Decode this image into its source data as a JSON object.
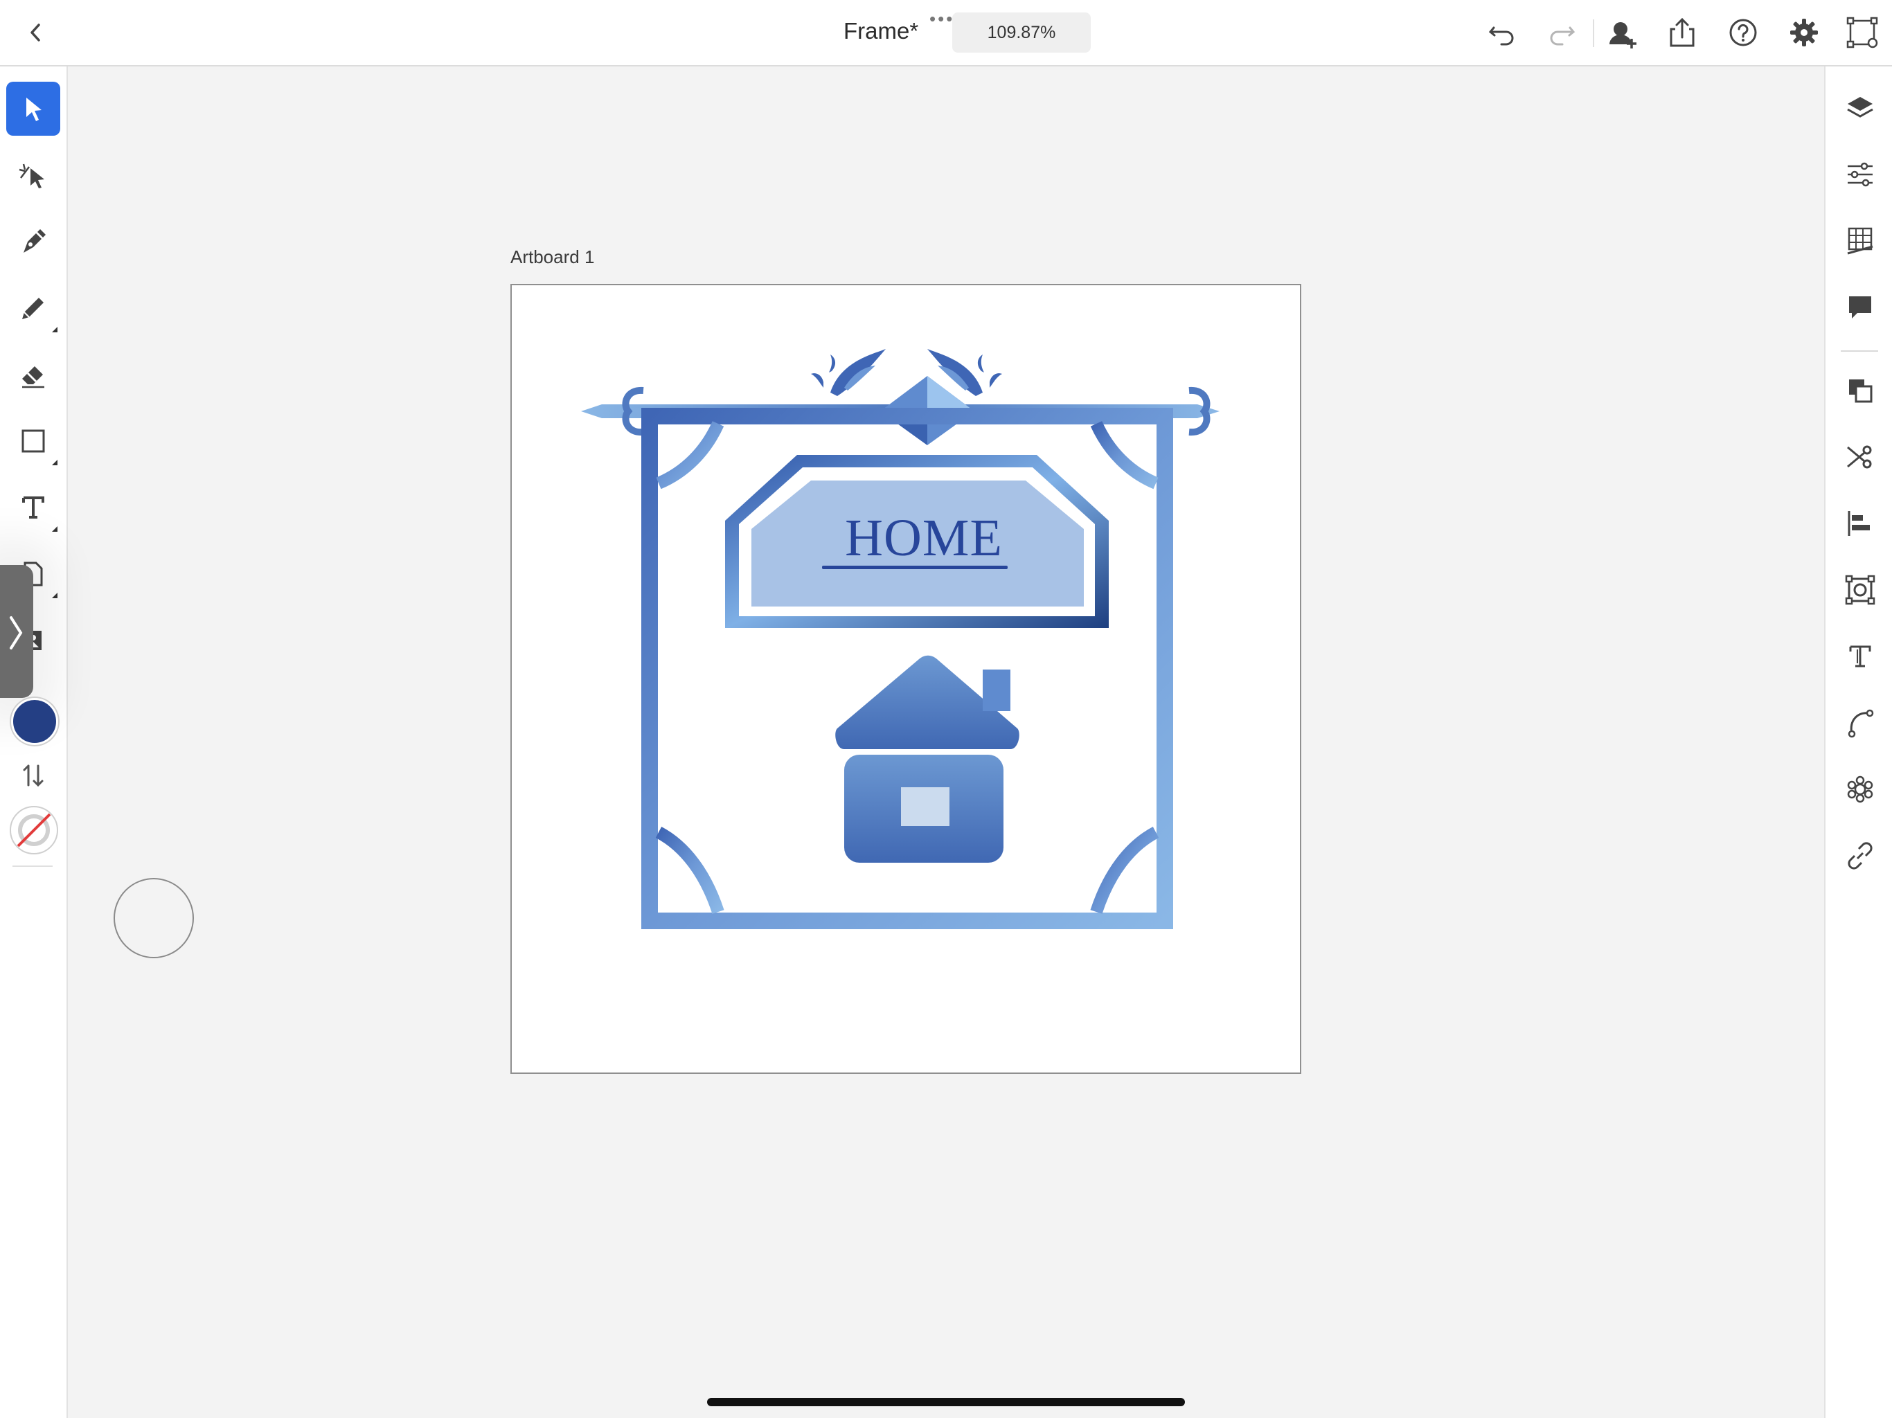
{
  "window": {
    "title": "Frame*",
    "zoom": "109.87%"
  },
  "toolbar": {
    "left_icons": [
      "back-chevron-icon"
    ],
    "right_icons": [
      "undo-icon",
      "redo-icon",
      "invite-user-icon",
      "share-icon",
      "help-icon",
      "settings-icon",
      "transform-icon"
    ]
  },
  "tools": [
    "select-icon",
    "direct-select-icon",
    "pen-icon",
    "pencil-icon",
    "eraser-icon",
    "rectangle-icon",
    "text-icon",
    "place-file-icon",
    "image-icon"
  ],
  "colors": {
    "accent": "#2d6ee4",
    "fill": "#243f84",
    "stroke": "none",
    "frame_blue": "#4f79c0",
    "light_blue": "#8db8e6",
    "plaque_fill": "#a8c2e6"
  },
  "right_panel": [
    "layers-icon",
    "properties-icon",
    "swatches-icon",
    "comments-icon",
    "arrange-icon",
    "path-operations-icon",
    "align-icon",
    "repeat-icon",
    "glyphs-icon",
    "path-icon",
    "symbols-icon",
    "links-icon"
  ],
  "canvas": {
    "artboard_label": "Artboard 1",
    "sign_text": "HOME"
  }
}
